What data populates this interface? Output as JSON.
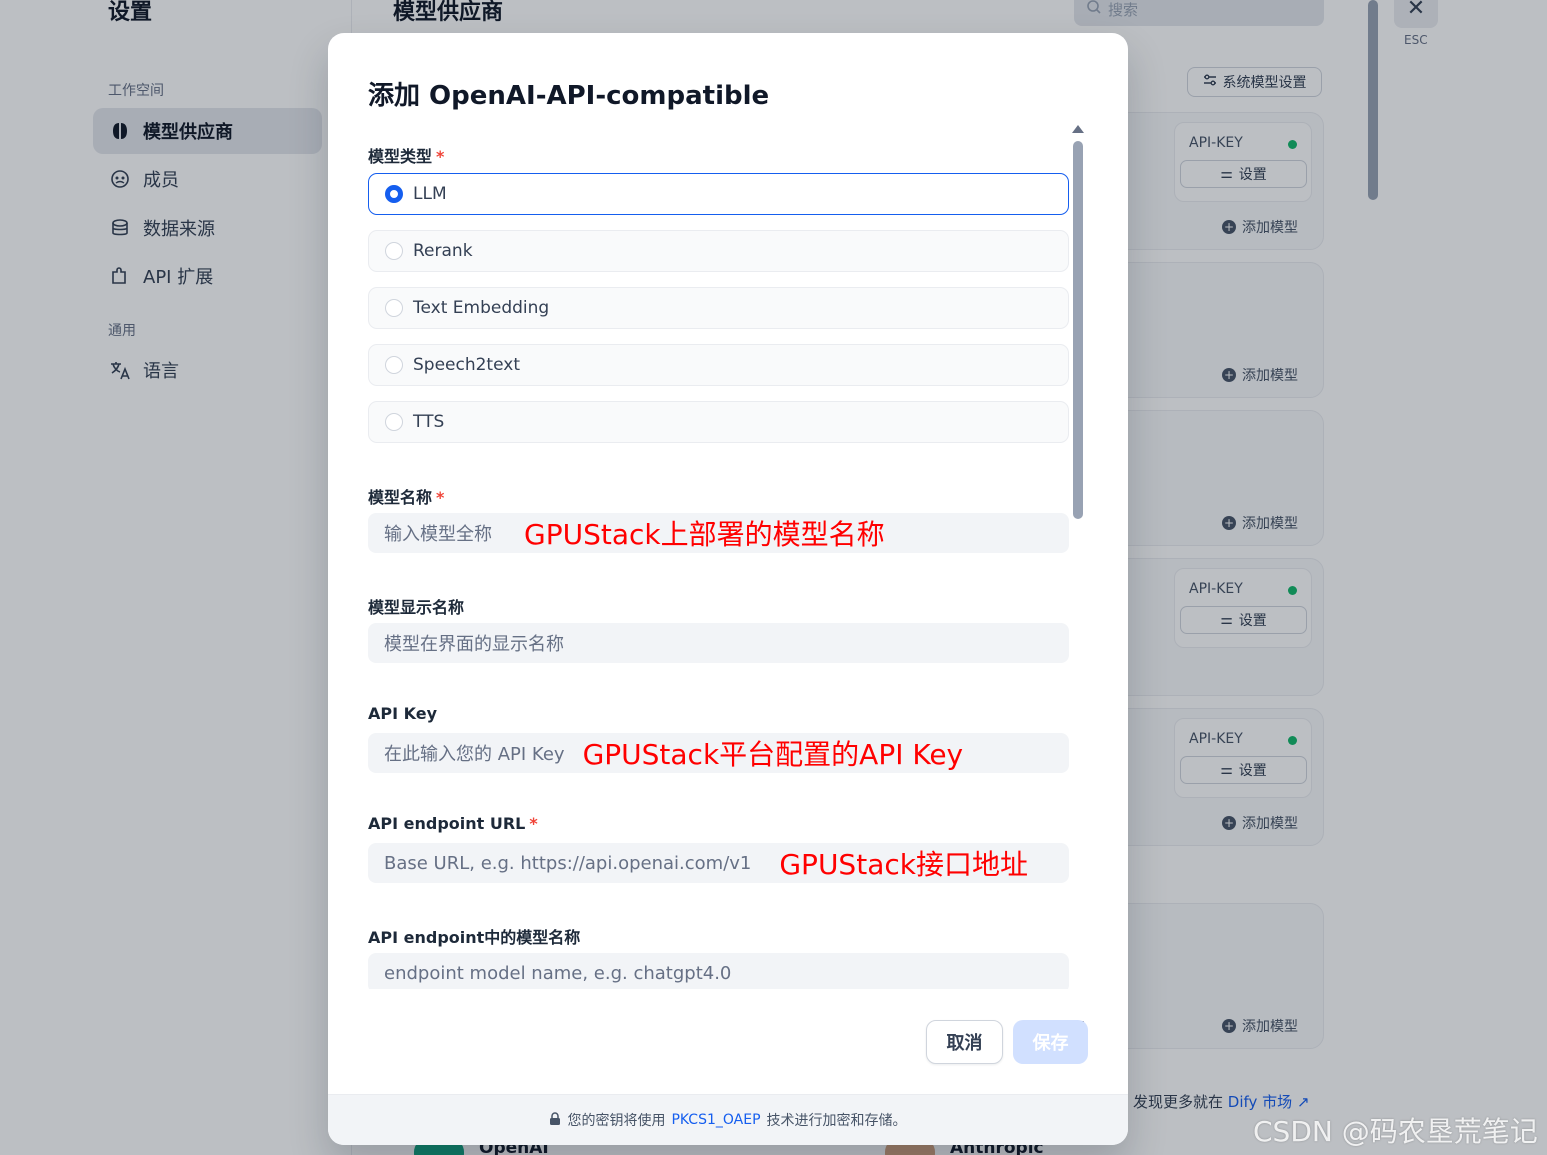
{
  "sidebar": {
    "title": "设置",
    "section_workspace": "工作空间",
    "items": [
      {
        "label": "模型供应商"
      },
      {
        "label": "成员"
      },
      {
        "label": "数据来源"
      },
      {
        "label": "API 扩展"
      }
    ],
    "section_general": "通用",
    "language_label": "语言"
  },
  "header": {
    "title": "模型供应商",
    "search_placeholder": "搜索",
    "system_model_settings": "系统模型设置",
    "esc_label": "ESC"
  },
  "cards": {
    "api_key_label": "API-KEY",
    "settings_label": "设置",
    "add_model_label": "添加模型"
  },
  "dify": {
    "prefix": "发现更多就在",
    "link": "Dify 市场 ↗"
  },
  "bottom_providers": [
    "OpenAI",
    "Anthropic"
  ],
  "modal": {
    "title": "添加 OpenAI-API-compatible",
    "model_type_label": "模型类型",
    "model_types": [
      "LLM",
      "Rerank",
      "Text Embedding",
      "Speech2text",
      "TTS"
    ],
    "selected_type": "LLM",
    "model_name_label": "模型名称",
    "model_name_placeholder": "输入模型全称",
    "model_name_annotation": "GPUStack上部署的模型名称",
    "display_name_label": "模型显示名称",
    "display_name_placeholder": "模型在界面的显示名称",
    "api_key_label": "API Key",
    "api_key_placeholder": "在此输入您的 API Key",
    "api_key_annotation": "GPUStack平台配置的API Key",
    "endpoint_label": "API endpoint URL",
    "endpoint_placeholder": "Base URL, e.g. https://api.openai.com/v1",
    "endpoint_annotation": "GPUStack接口地址",
    "endpoint_model_label": "API endpoint中的模型名称",
    "endpoint_model_placeholder": "endpoint model name, e.g. chatgpt4.0",
    "required_mark": "*",
    "cancel_label": "取消",
    "save_label": "保存",
    "footer_prefix": "您的密钥将使用",
    "footer_link": "PKCS1_OAEP",
    "footer_suffix": "技术进行加密和存储。"
  },
  "watermark": "CSDN @码农垦荒笔记"
}
